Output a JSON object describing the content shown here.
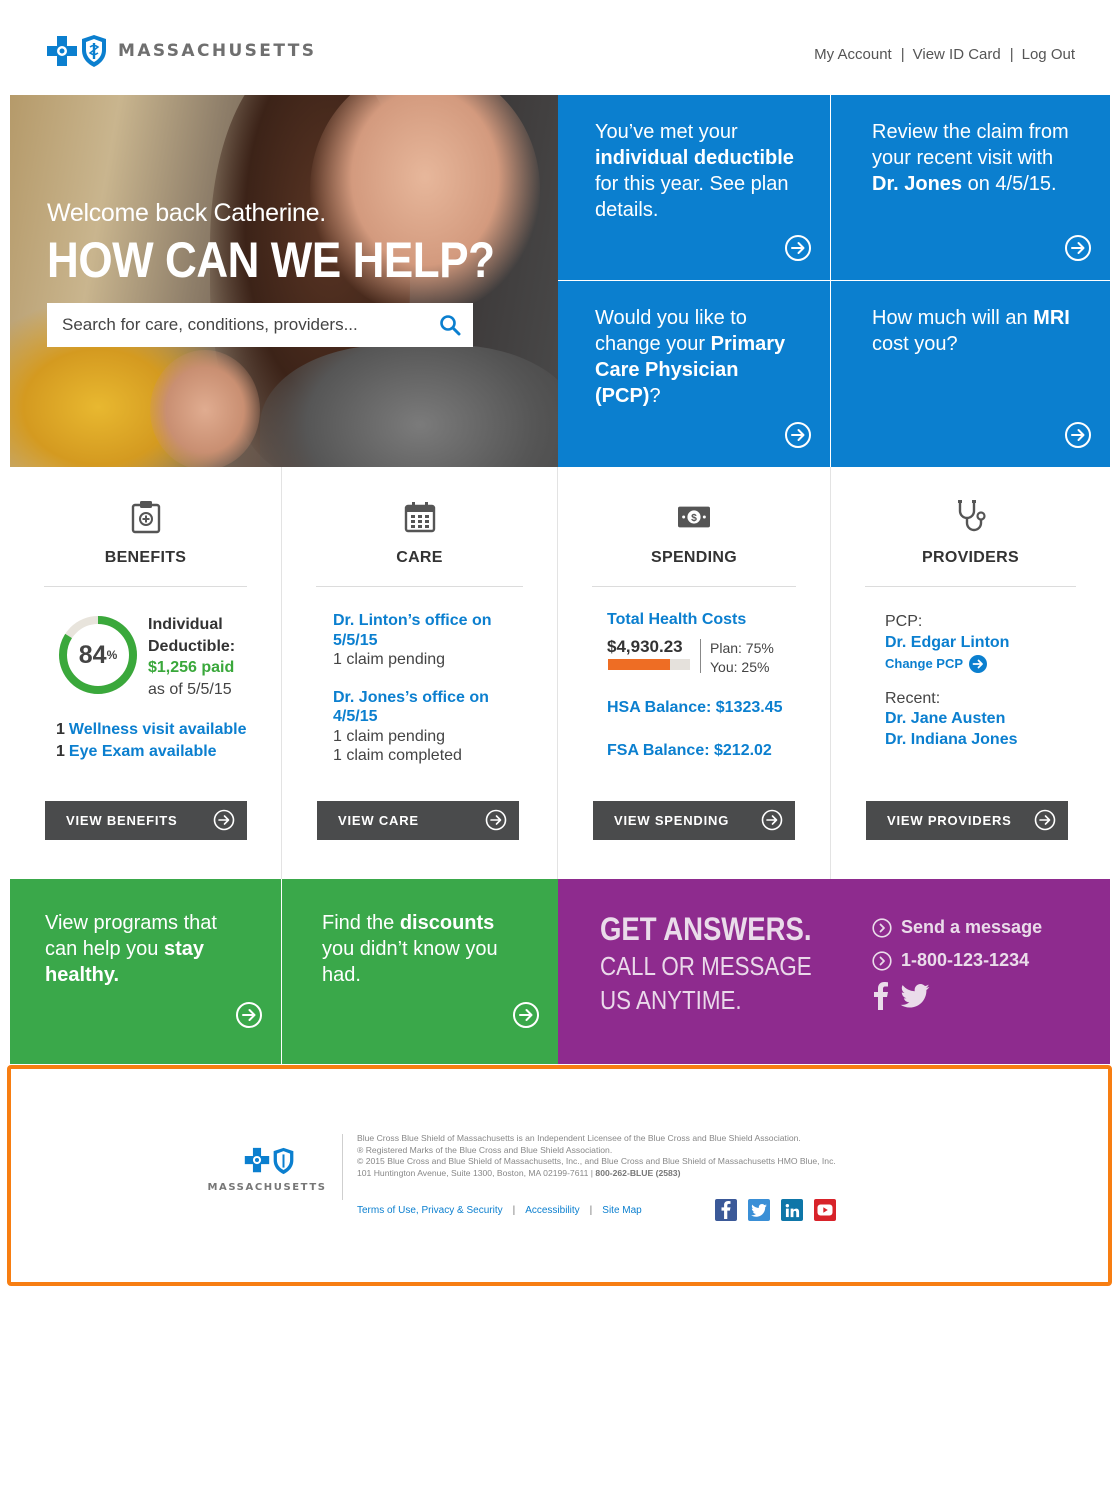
{
  "brand": {
    "name": "MASSACHUSETTS",
    "color_blue": "#0b7fcf",
    "color_green": "#3aa84a",
    "color_purple": "#8e2b8e",
    "color_orange": "#ee6d24"
  },
  "top_nav": [
    "My Account",
    "View ID Card",
    "Log Out"
  ],
  "hero": {
    "welcome": "Welcome back Catherine.",
    "title": "HOW CAN WE HELP?",
    "search_placeholder": "Search for care, conditions, providers..."
  },
  "tiles": {
    "t1": {
      "a": "You’ve met your ",
      "b": "individual deductible",
      "c": " for this year. See plan details."
    },
    "t2": {
      "a": "Review the claim from your recent visit with ",
      "b": "Dr. Jones",
      "c": " on 4/5/15."
    },
    "t3": {
      "a": "Would you like to change your ",
      "b": "Primary Care Physician (PCP)",
      "c": "?"
    },
    "t4": {
      "a": "How much will an ",
      "b": "MRI",
      "c": " cost you?"
    }
  },
  "benefits": {
    "title": "BENEFITS",
    "percent_value": 84,
    "percent": "84",
    "percent_sign": "%",
    "line1": "Individual",
    "line2": "Deductible:",
    "paid": "$1,256 paid",
    "asof": "as of 5/5/15",
    "items": [
      {
        "count": "1",
        "label": "Wellness visit available"
      },
      {
        "count": "1",
        "label": "Eye Exam available"
      }
    ],
    "button": "VIEW BENEFITS"
  },
  "care": {
    "title": "CARE",
    "groups": [
      {
        "office": "Dr. Linton’s office on 5/5/15",
        "status": [
          "1 claim pending"
        ]
      },
      {
        "office": "Dr. Jones’s office on 4/5/15",
        "status": [
          "1 claim pending",
          "1 claim completed"
        ]
      }
    ],
    "button": "VIEW CARE"
  },
  "spending": {
    "title": "SPENDING",
    "total_label": "Total Health Costs",
    "total_amount": "$4,930.23",
    "plan": "Plan: 75%",
    "you": "You: 25%",
    "plan_share": 0.75,
    "hsa": "HSA Balance: $1323.45",
    "fsa": "FSA Balance: $212.02",
    "button": "VIEW SPENDING"
  },
  "providers": {
    "title": "PROVIDERS",
    "pcp_label": "PCP:",
    "pcp_name": "Dr. Edgar Linton",
    "change_pcp": "Change PCP",
    "recent_label": "Recent:",
    "recent": [
      "Dr. Jane Austen",
      "Dr. Indiana Jones"
    ],
    "button": "VIEW PROVIDERS"
  },
  "green_tiles": {
    "g1": {
      "a": "View programs that can help you ",
      "b": "stay healthy."
    },
    "g2": {
      "a": "Find the ",
      "b": "discounts",
      "c": " you didn’t know you had."
    }
  },
  "answers": {
    "title": "GET ANSWERS.",
    "sub1": "CALL OR MESSAGE",
    "sub2": "US ANYTIME.",
    "message": "Send a message",
    "phone": "1-800-123-1234"
  },
  "footer": {
    "logo_name": "MASSACHUSETTS",
    "lines": [
      "Blue Cross Blue Shield of Massachusetts is an Independent Licensee of the Blue Cross and Blue Shield Association.",
      "® Registered Marks of the Blue Cross and Blue Shield Association.",
      "© 2015 Blue Cross and Blue Shield of Massachusetts, Inc., and Blue Cross and Blue Shield of Massachusetts HMO Blue, Inc."
    ],
    "address": "101 Huntington Avenue, Suite 1300, Boston, MA 02199-7611 | ",
    "phone": "800-262-BLUE (2583)",
    "links": [
      "Terms of Use, Privacy & Security",
      "Accessibility",
      "Site Map"
    ],
    "social_icons": [
      "facebook-icon",
      "twitter-icon",
      "linkedin-icon",
      "youtube-icon"
    ]
  }
}
